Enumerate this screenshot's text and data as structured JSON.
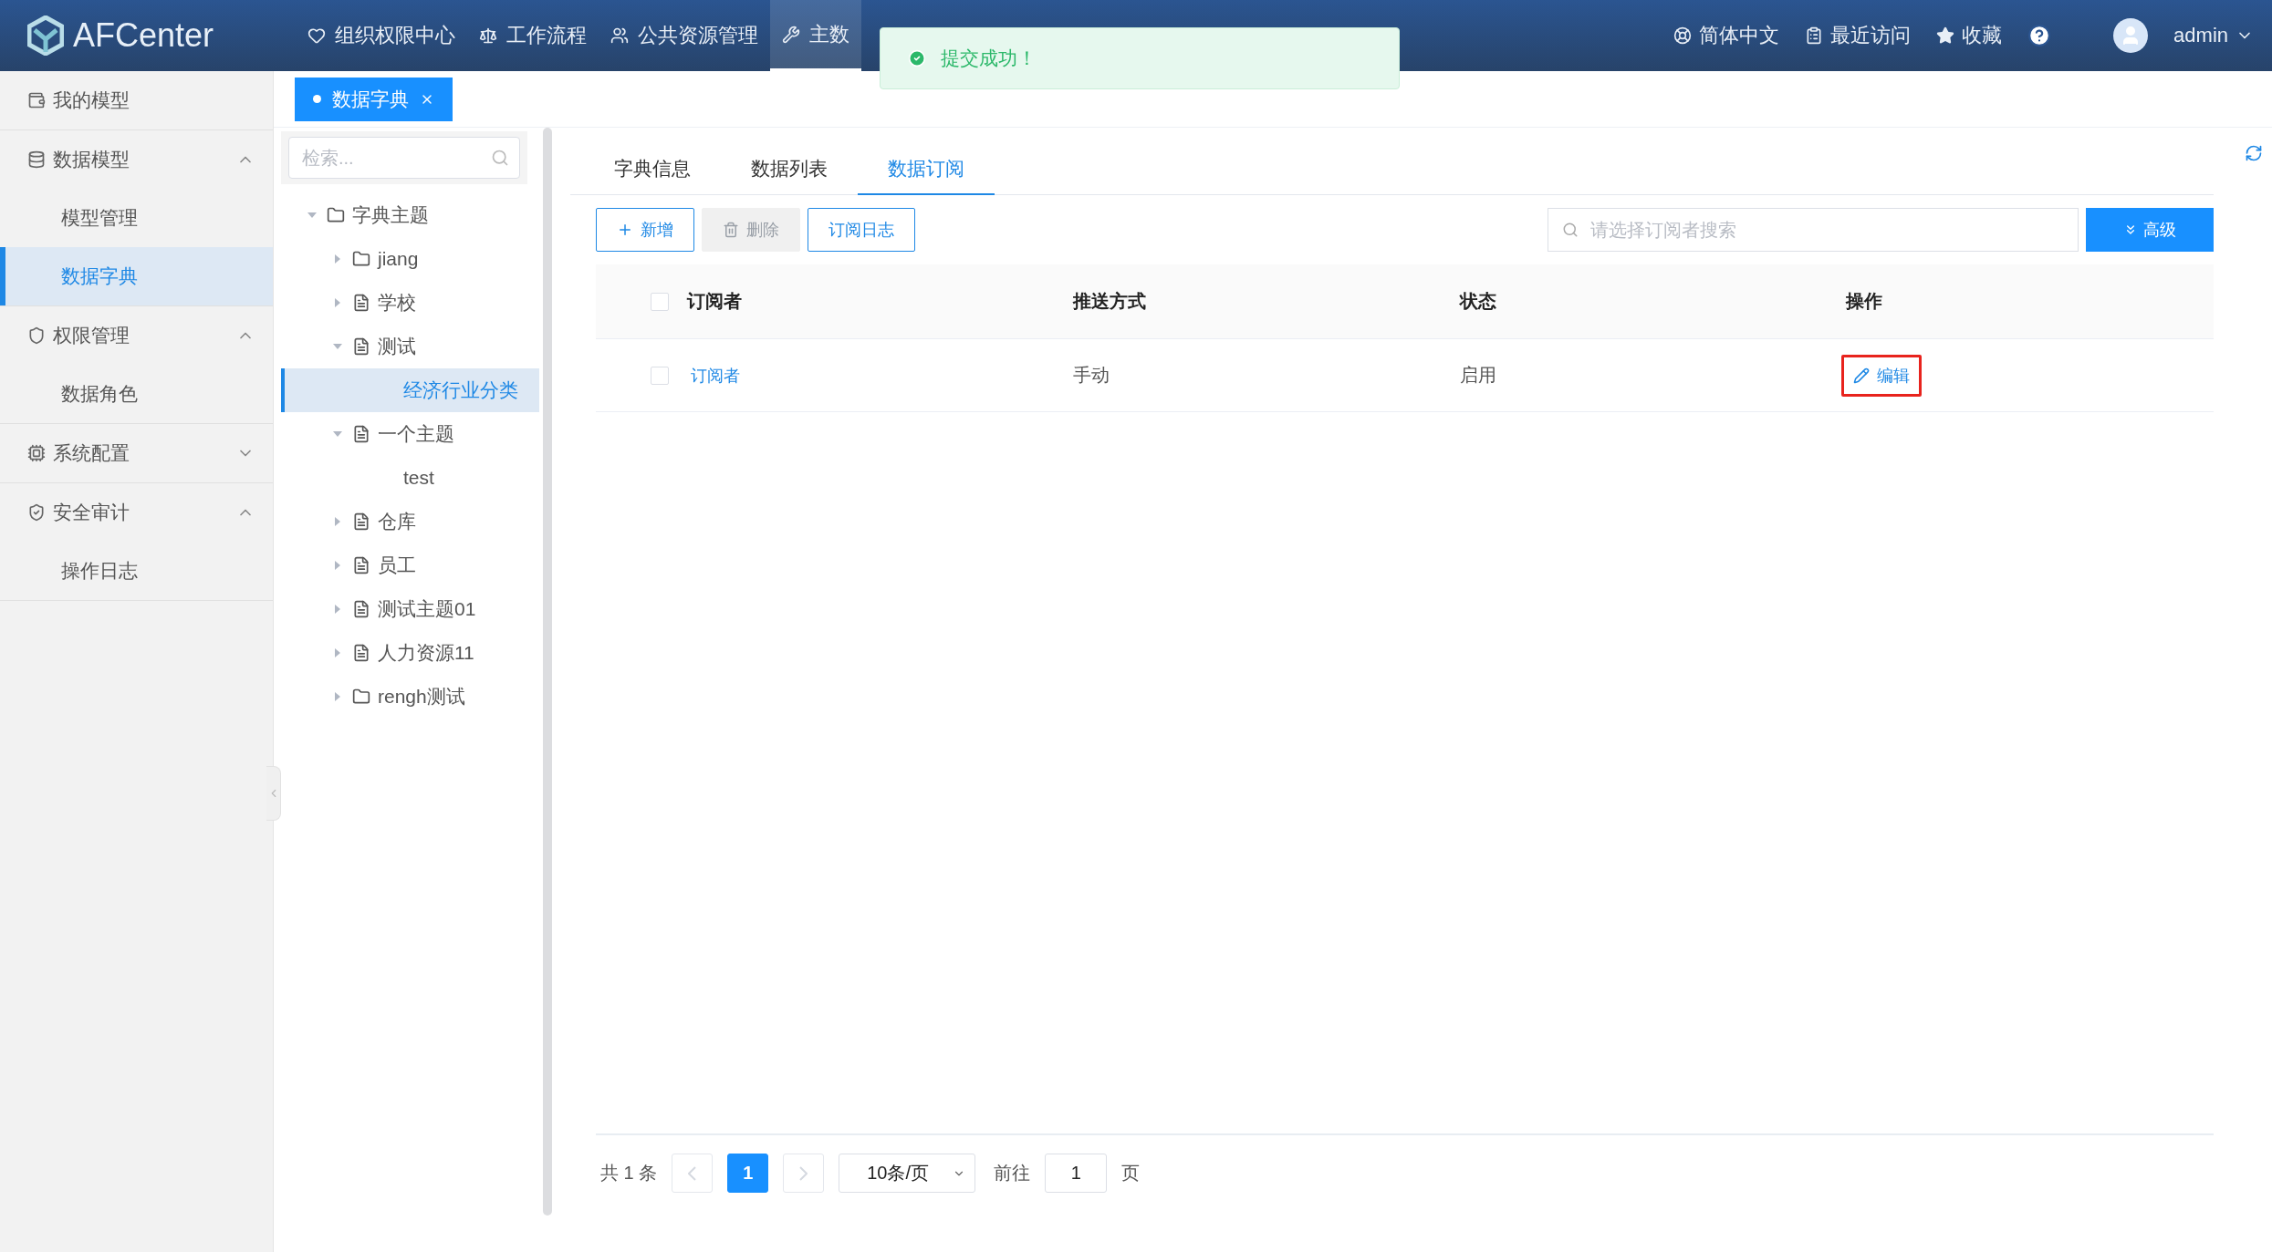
{
  "header": {
    "logo": "AFCenter",
    "nav": [
      {
        "label": "组织权限中心",
        "selected": false
      },
      {
        "label": "工作流程",
        "selected": false
      },
      {
        "label": "公共资源管理",
        "selected": false
      },
      {
        "label": "主数",
        "selected": true
      }
    ],
    "tools": [
      {
        "label": "简体中文"
      },
      {
        "label": "最近访问"
      },
      {
        "label": "收藏"
      }
    ],
    "user": "admin"
  },
  "toast": {
    "message": "提交成功！"
  },
  "sidebar": {
    "items": [
      {
        "kind": "item",
        "label": "我的模型",
        "selected": false
      },
      {
        "kind": "group",
        "label": "数据模型",
        "selected": false,
        "expanded": true,
        "children": [
          {
            "label": "模型管理",
            "selected": false
          },
          {
            "label": "数据字典",
            "selected": true
          }
        ]
      },
      {
        "kind": "group",
        "label": "权限管理",
        "selected": false,
        "expanded": true,
        "children": [
          {
            "label": "数据角色",
            "selected": false
          }
        ]
      },
      {
        "kind": "group",
        "label": "系统配置",
        "selected": false,
        "expanded": false
      },
      {
        "kind": "group",
        "label": "安全审计",
        "selected": false,
        "expanded": true,
        "children": [
          {
            "label": "操作日志",
            "selected": false
          }
        ]
      }
    ]
  },
  "open_tabs": [
    {
      "label": "数据字典",
      "selected": true
    }
  ],
  "tree": {
    "search": {
      "placeholder": "检索..."
    },
    "nodes": [
      {
        "label": "字典主题",
        "kind": "folder",
        "expanded": true,
        "selected": false,
        "children": [
          {
            "label": "jiang",
            "kind": "folder",
            "expanded": false,
            "selected": false
          },
          {
            "label": "学校",
            "kind": "file",
            "expanded": false,
            "selected": false
          },
          {
            "label": "测试",
            "kind": "file",
            "expanded": true,
            "selected": false,
            "children": [
              {
                "label": "经济行业分类",
                "kind": "plain",
                "selected": true
              }
            ]
          },
          {
            "label": "一个主题",
            "kind": "file",
            "expanded": true,
            "selected": false,
            "children": [
              {
                "label": "test",
                "kind": "plain",
                "selected": false
              }
            ]
          },
          {
            "label": "仓库",
            "kind": "file",
            "expanded": false,
            "selected": false
          },
          {
            "label": "员工",
            "kind": "file",
            "expanded": false,
            "selected": false
          },
          {
            "label": "测试主题01",
            "kind": "file",
            "expanded": false,
            "selected": false
          },
          {
            "label": "人力资源11",
            "kind": "file",
            "expanded": false,
            "selected": false
          },
          {
            "label": "rengh测试",
            "kind": "folder",
            "expanded": false,
            "selected": false
          }
        ]
      }
    ]
  },
  "content": {
    "tabs": [
      {
        "label": "字典信息",
        "selected": false
      },
      {
        "label": "数据列表",
        "selected": false
      },
      {
        "label": "数据订阅",
        "selected": true
      }
    ],
    "toolbar": {
      "buttons": [
        {
          "label": "新增",
          "kind": "add",
          "disabled": false
        },
        {
          "label": "删除",
          "kind": "delete",
          "disabled": true
        },
        {
          "label": "订阅日志",
          "kind": "plain",
          "disabled": false
        }
      ],
      "search": {
        "placeholder": "请选择订阅者搜索"
      },
      "advanced": "高级"
    },
    "table": {
      "header_checked": false,
      "columns": [
        "订阅者",
        "推送方式",
        "状态",
        "操作"
      ],
      "rows": [
        {
          "checked": false,
          "subscriber": "订阅者",
          "push": "手动",
          "status": "启用",
          "action": {
            "label": "编辑",
            "highlighted": true
          }
        }
      ]
    },
    "pagination": {
      "total": "共 1 条",
      "prev_disabled": true,
      "pages": [
        {
          "label": "1",
          "selected": true
        }
      ],
      "next_disabled": true,
      "page_size": "10条/页",
      "goto_label": "前往",
      "goto_value": "1",
      "page_unit": "页"
    }
  }
}
